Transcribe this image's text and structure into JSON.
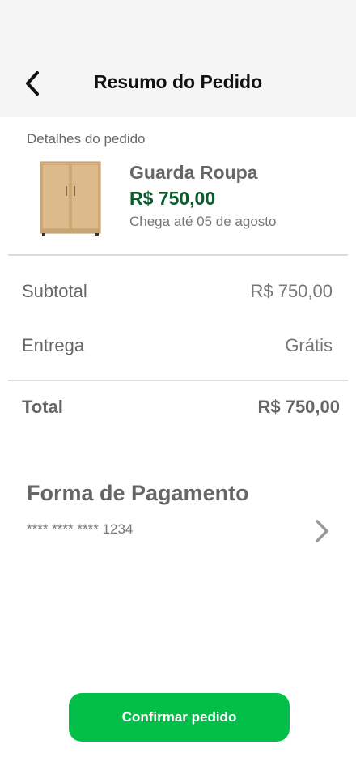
{
  "header": {
    "title": "Resumo do Pedido",
    "back_icon": "chevron-left-icon"
  },
  "order": {
    "section_label": "Detalhes do pedido",
    "product": {
      "name": "Guarda Roupa",
      "price": "R$ 750,00",
      "eta": "Chega até 05 de agosto",
      "image_icon": "wardrobe-image"
    }
  },
  "summary": {
    "subtotal_label": "Subtotal",
    "subtotal_value": "R$ 750,00",
    "delivery_label": "Entrega",
    "delivery_value": "Grátis",
    "total_label": "Total",
    "total_value": "R$ 750,00"
  },
  "payment": {
    "title": "Forma de Pagamento",
    "card_number": "**** **** **** 1234",
    "chevron_icon": "chevron-right-icon"
  },
  "actions": {
    "confirm_label": "Confirmar pedido"
  },
  "colors": {
    "header_bg": "#f5f5f5",
    "price_green": "#0a5c2b",
    "button_green": "#03bf4a",
    "divider": "#dddddd"
  }
}
